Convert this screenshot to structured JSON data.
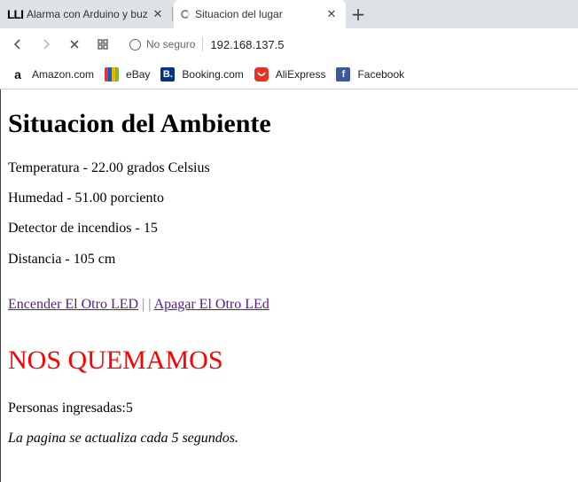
{
  "browser": {
    "tabs": [
      {
        "title": "Alarma con Arduino y buz",
        "favicon_text": "LLI"
      },
      {
        "title": "Situacion del lugar"
      }
    ],
    "address": {
      "security_label": "No seguro",
      "url": "192.168.137.5"
    },
    "bookmarks": [
      {
        "label": "Amazon.com",
        "icon": "a",
        "icon_name": "amazon-icon"
      },
      {
        "label": "eBay",
        "icon": "",
        "icon_name": "ebay-icon"
      },
      {
        "label": "Booking.com",
        "icon": "B.",
        "icon_name": "booking-icon"
      },
      {
        "label": "AliExpress",
        "icon": "",
        "icon_name": "aliexpress-icon"
      },
      {
        "label": "Facebook",
        "icon": "f",
        "icon_name": "facebook-icon"
      }
    ]
  },
  "page": {
    "title": "Situacion del Ambiente",
    "readings": {
      "temperature": "Temperatura - 22.00 grados Celsius",
      "humidity": "Humedad - 51.00 porciento",
      "fire_detector": "Detector de incendios - 15",
      "distance": "Distancia - 105 cm"
    },
    "links": {
      "on": "Encender El Otro LED",
      "separator": " | | ",
      "off": "Apagar El Otro LEd"
    },
    "alert": "NOS QUEMAMOS",
    "people": "Personas ingresadas:5",
    "refresh_note": "La pagina se actualiza cada 5 segundos."
  },
  "colors": {
    "alert": "#ff0000",
    "visited_link": "#551a8b",
    "tabstrip": "#dee1e6"
  }
}
